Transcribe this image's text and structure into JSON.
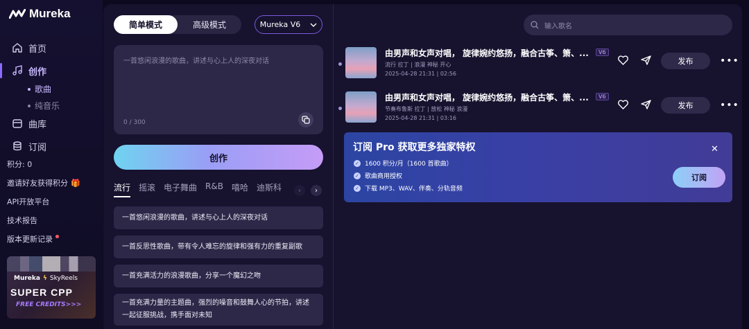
{
  "app": {
    "name": "Mureka"
  },
  "sidebar": {
    "nav": [
      {
        "label": "首页",
        "icon": "home-icon"
      },
      {
        "label": "创作",
        "icon": "music-note-icon"
      },
      {
        "label": "曲库",
        "icon": "library-icon"
      },
      {
        "label": "订阅",
        "icon": "subscribe-icon"
      }
    ],
    "sub": [
      {
        "label": "歌曲"
      },
      {
        "label": "纯音乐"
      }
    ],
    "credits": "积分: 0",
    "invite": "邀请好友获得积分",
    "api": "API开放平台",
    "report": "技术报告",
    "changelog": "版本更新记录",
    "promo": {
      "brand1": "Mureka",
      "brand2": "SkyReels",
      "title": "SUPER CPP",
      "credits": "FREE CREDITS>>>"
    }
  },
  "composer": {
    "modes": [
      "简单模式",
      "高级模式"
    ],
    "version": "Mureka V6",
    "placeholder": "一首悠闲浪漫的歌曲，讲述与心上人的深夜对话",
    "counter": "0 / 300",
    "create": "创作",
    "genres": [
      "流行",
      "摇滚",
      "电子舞曲",
      "R&B",
      "嘻哈",
      "迪斯科"
    ],
    "suggestions": [
      "一首悠闲浪漫的歌曲，讲述与心上人的深夜对话",
      "一首反思性歌曲，带有令人难忘的旋律和强有力的重复副歌",
      "一首充满活力的浪漫歌曲，分享一个魔幻之吻",
      "一首充满力量的主题曲，强烈的噪音和鼓舞人心的节拍，讲述一起征服挑战，携手面对未知"
    ]
  },
  "search": {
    "placeholder": "输入歌名"
  },
  "songs": [
    {
      "title": "由男声和女声对唱， 旋律婉约悠扬，融合古筝、箫、...",
      "badge": "V6",
      "tags": "流行 拉丁 | 浪漫 神秘 开心",
      "meta": "2025-04-28 21:31 | 02:56",
      "publish": "发布"
    },
    {
      "title": "由男声和女声对唱， 旋律婉约悠扬，融合古筝、箫、...",
      "badge": "V6",
      "tags": "节奏布鲁斯 拉丁 | 放松 神秘 浪漫",
      "meta": "2025-04-28 21:31 | 03:16",
      "publish": "发布"
    }
  ],
  "pro": {
    "title": "订阅 Pro 获取更多独家特权",
    "features": [
      "1600 积分/月（1600 首歌曲）",
      "歌曲商用授权",
      "下载 MP3、WAV、伴奏、分轨音频"
    ],
    "subscribe": "订阅"
  }
}
